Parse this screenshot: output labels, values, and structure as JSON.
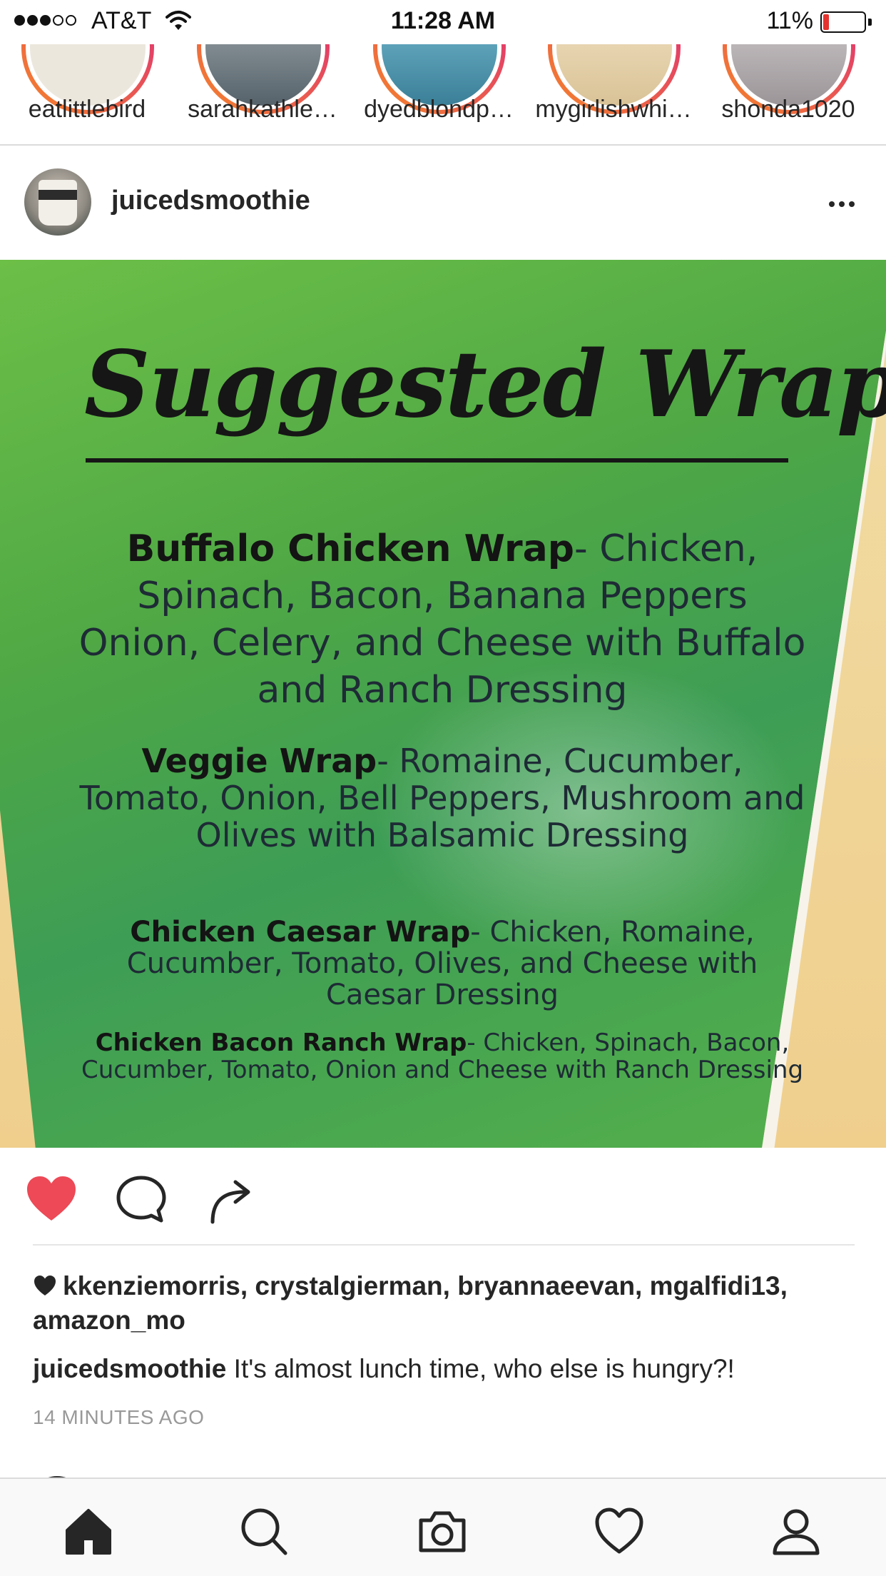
{
  "status_bar": {
    "carrier": "AT&T",
    "time": "11:28 AM",
    "battery": "11%",
    "signal_bars_filled": 3,
    "signal_bars_total": 5
  },
  "stories": [
    {
      "name": "eatlittlebird",
      "color": "#e8e2d6"
    },
    {
      "name": "sarahkathle…",
      "color": "#7d8a92"
    },
    {
      "name": "dyedblondp…",
      "color": "#5aa0b6"
    },
    {
      "name": "mygirlishwhi…",
      "color": "#e9d9b8"
    },
    {
      "name": "shonda1020",
      "color": "#c9c3c6"
    }
  ],
  "post": {
    "username": "juicedsmoothie",
    "avatar_text": "JUICED",
    "photo": {
      "title": "Suggested Wraps",
      "items": [
        {
          "name": "Buffalo Chicken Wrap",
          "description": "- Chicken, Spinach, Bacon, Banana Peppers Onion, Celery, and Cheese with Buffalo and Ranch Dressing"
        },
        {
          "name": "Veggie Wrap",
          "description": "- Romaine, Cucumber, Tomato, Onion, Bell Peppers, Mushroom and Olives with Balsamic Dressing"
        },
        {
          "name": "Chicken Caesar Wrap",
          "description": "- Chicken, Romaine, Cucumber, Tomato, Olives, and Cheese with Caesar Dressing"
        },
        {
          "name": "Chicken Bacon Ranch Wrap",
          "description": "- Chicken, Spinach, Bacon, Cucumber, Tomato, Onion and Cheese with Ranch Dressing"
        }
      ]
    },
    "liked": true,
    "likes_text": "kkenziemorris, crystalgierman, bryannaeevan, mgalfidi13, amazon_mo",
    "caption_user": "juicedsmoothie",
    "caption_text": "It's almost lunch time, who else is hungry?!",
    "timestamp": "14 MINUTES AGO"
  },
  "colors": {
    "like_red": "#ed4956",
    "story_ring_start": "#f58529",
    "story_ring_end": "#dd2a7b",
    "text_primary": "#262626",
    "text_muted": "#999999"
  },
  "tabs": [
    {
      "icon": "home-icon",
      "active": true
    },
    {
      "icon": "search-icon",
      "active": false
    },
    {
      "icon": "camera-icon",
      "active": false
    },
    {
      "icon": "heart-icon",
      "active": false
    },
    {
      "icon": "profile-icon",
      "active": false
    }
  ]
}
